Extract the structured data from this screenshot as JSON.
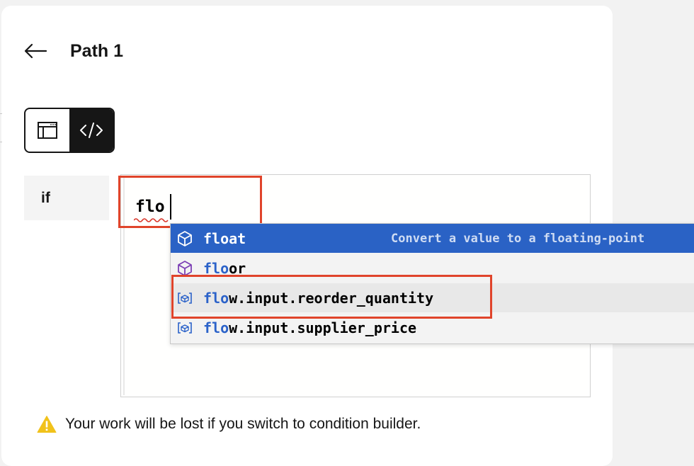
{
  "header": {
    "title": "Path 1",
    "back_icon": "arrow-left-icon"
  },
  "mode_toggle": {
    "options": [
      {
        "icon": "condition-builder-icon",
        "active": false
      },
      {
        "icon": "code-icon",
        "active": true
      }
    ]
  },
  "condition": {
    "label": "if",
    "editor_value": "flo"
  },
  "suggestions": [
    {
      "match": "flo",
      "rest": "at",
      "icon": "cube-icon",
      "icon_color": "#ffffff",
      "description": "Convert a value to a floating-point",
      "state": "selected"
    },
    {
      "match": "flo",
      "rest": "or",
      "icon": "cube-icon",
      "icon_color": "#7c3fb5",
      "description": "",
      "state": "normal"
    },
    {
      "match": "flo",
      "rest": "w.input.reorder_quantity",
      "icon": "variable-icon",
      "icon_color": "#2b62c9",
      "description": "",
      "state": "hover"
    },
    {
      "match": "flo",
      "rest": "w.input.supplier_price",
      "icon": "variable-icon",
      "icon_color": "#2b62c9",
      "description": "",
      "state": "normal"
    }
  ],
  "warning": {
    "icon": "warning-icon",
    "text": "Your work will be lost if you switch to condition builder."
  },
  "colors": {
    "selected_row": "#2a62c5",
    "highlight_box": "#e0442b",
    "match_text": "#2b62c9"
  }
}
